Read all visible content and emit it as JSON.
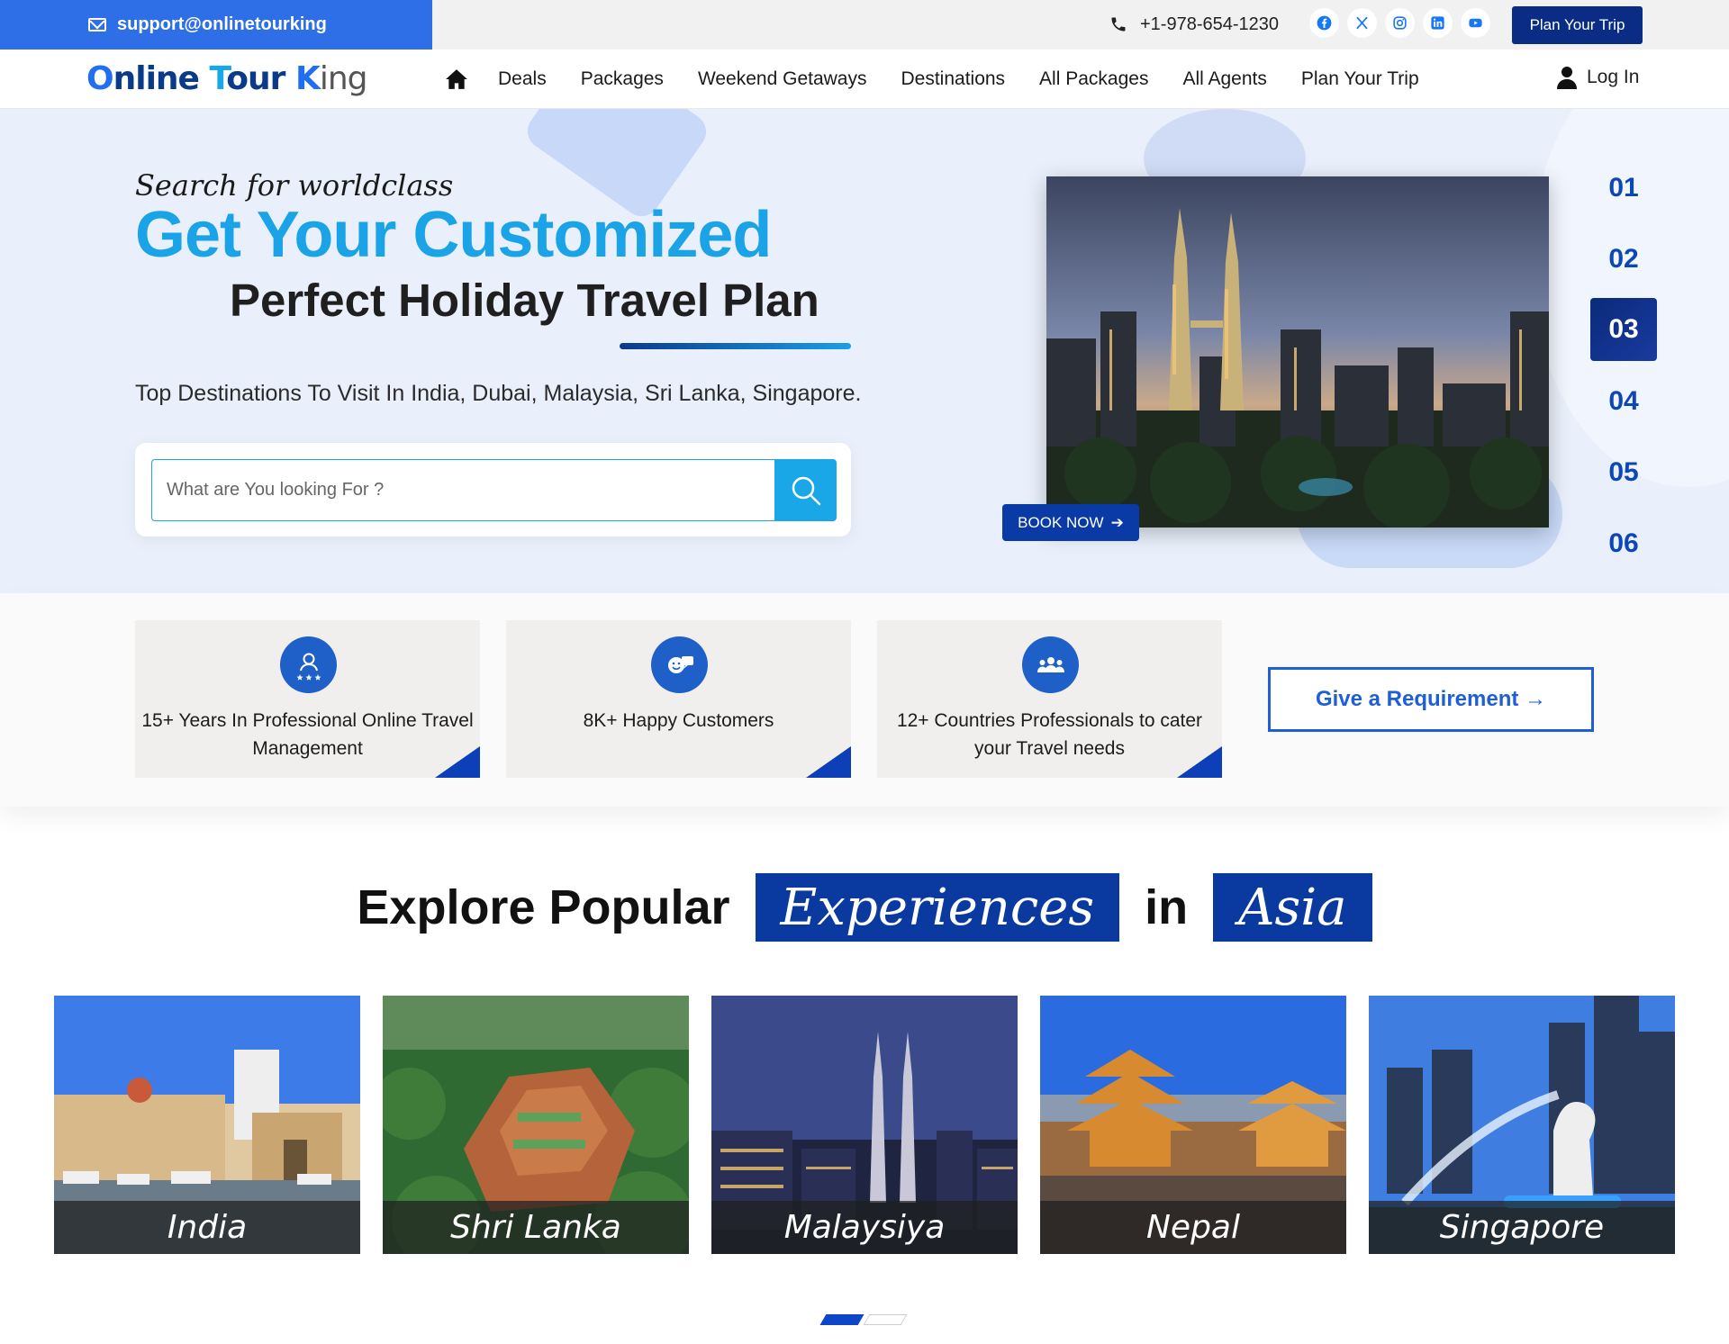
{
  "topbar": {
    "email": "support@onlinetourking",
    "phone": "+1-978-654-1230",
    "socials": [
      "facebook-icon",
      "x-icon",
      "instagram-icon",
      "linkedin-icon",
      "youtube-icon"
    ],
    "plan_button": "Plan Your Trip"
  },
  "nav": {
    "logo": {
      "part1": "O",
      "part2": "nline ",
      "part3": "T",
      "part4": "our ",
      "part5": "K",
      "part6": "ing"
    },
    "links": [
      "Deals",
      "Packages",
      "Weekend Getaways",
      "Destinations",
      "All Packages",
      "All Agents",
      "Plan Your Trip"
    ],
    "login": "Log In"
  },
  "hero": {
    "tagline": "Search for worldclass",
    "headline1": "Get Your Customized",
    "headline2": "Perfect Holiday Travel Plan",
    "subline": "Top Destinations To Visit In India, Dubai, Malaysia, Sri Lanka, Singapore.",
    "search_placeholder": "What are You looking For ?",
    "book_now": "BOOK NOW",
    "slides": [
      "01",
      "02",
      "03",
      "04",
      "05",
      "06"
    ],
    "active_slide": "03"
  },
  "stats": [
    {
      "icon": "rated-user-icon",
      "text": "15+ Years In Professional Online Travel Management"
    },
    {
      "icon": "happy-chat-icon",
      "text": "8K+ Happy Customers"
    },
    {
      "icon": "group-icon",
      "text": "12+ Countries Professionals to cater your Travel needs"
    }
  ],
  "requirement_button": "Give a Requirement →",
  "explore": {
    "part1": "Explore Popular",
    "part2": "Experiences",
    "part3": "in",
    "part4": "Asia"
  },
  "destinations": [
    "India",
    "Shri Lanka",
    "Malaysiya",
    "Nepal",
    "Singapore"
  ],
  "carousel": {
    "pages": 2,
    "active": 1
  },
  "colors": {
    "brand_blue": "#0a3aa0",
    "accent_cyan": "#1aa3e6",
    "topbar_blue": "#2e6ee6"
  }
}
